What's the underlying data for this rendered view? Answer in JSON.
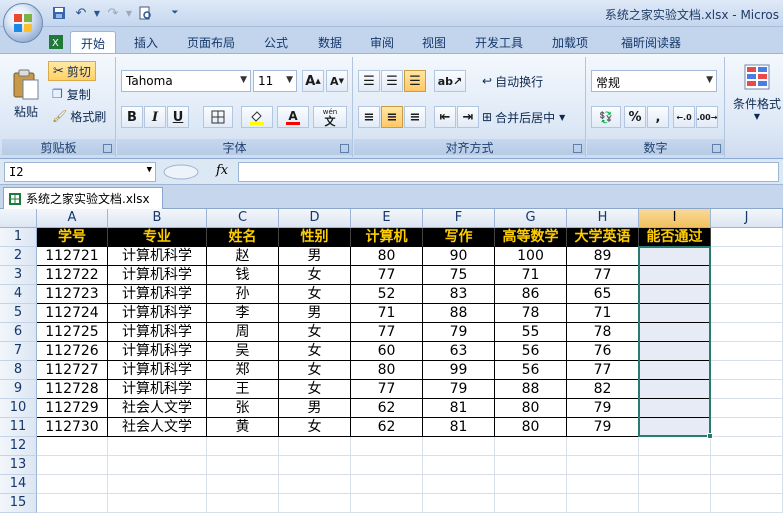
{
  "window": {
    "title": "系统之家实验文档.xlsx - Micros"
  },
  "ribbon_tabs": [
    "开始",
    "插入",
    "页面布局",
    "公式",
    "数据",
    "审阅",
    "视图",
    "开发工具",
    "加载项",
    "福昕阅读器"
  ],
  "clipboard": {
    "paste": "粘贴",
    "cut": "剪切",
    "copy": "复制",
    "format_painter": "格式刷",
    "label": "剪贴板"
  },
  "font": {
    "name": "Tahoma",
    "size": "11",
    "label": "字体",
    "grow": "A",
    "shrink": "A",
    "bold": "B",
    "italic": "I",
    "underline": "U",
    "font_color": "A",
    "wen": "wén",
    "wen_char": "文"
  },
  "alignment": {
    "wrap": "自动换行",
    "merge": "合并后居中",
    "label": "对齐方式"
  },
  "number": {
    "format": "常规",
    "percent": "%",
    "comma": ",",
    "label": "数字"
  },
  "styles": {
    "conditional": "条件格式"
  },
  "formula_bar": {
    "cell_ref": "I2",
    "fx": "fx",
    "value": ""
  },
  "workbook_tab": {
    "name": "系统之家实验文档.xlsx"
  },
  "sheet": {
    "columns": [
      "A",
      "B",
      "C",
      "D",
      "E",
      "F",
      "G",
      "H",
      "I",
      "J"
    ],
    "rows": [
      "1",
      "2",
      "3",
      "4",
      "5",
      "6",
      "7",
      "8",
      "9",
      "10",
      "11",
      "12",
      "13",
      "14",
      "15"
    ],
    "headers": [
      "学号",
      "专业",
      "姓名",
      "性别",
      "计算机",
      "写作",
      "高等数学",
      "大学英语",
      "能否通过"
    ],
    "data": [
      [
        "112721",
        "计算机科学",
        "赵",
        "男",
        "80",
        "90",
        "100",
        "89",
        ""
      ],
      [
        "112722",
        "计算机科学",
        "钱",
        "女",
        "77",
        "75",
        "71",
        "77",
        ""
      ],
      [
        "112723",
        "计算机科学",
        "孙",
        "女",
        "52",
        "83",
        "86",
        "65",
        ""
      ],
      [
        "112724",
        "计算机科学",
        "李",
        "男",
        "71",
        "88",
        "78",
        "71",
        ""
      ],
      [
        "112725",
        "计算机科学",
        "周",
        "女",
        "77",
        "79",
        "55",
        "78",
        ""
      ],
      [
        "112726",
        "计算机科学",
        "吴",
        "女",
        "60",
        "63",
        "56",
        "76",
        ""
      ],
      [
        "112727",
        "计算机科学",
        "郑",
        "女",
        "80",
        "99",
        "56",
        "77",
        ""
      ],
      [
        "112728",
        "计算机科学",
        "王",
        "女",
        "77",
        "79",
        "88",
        "82",
        ""
      ],
      [
        "112729",
        "社会人文学",
        "张",
        "男",
        "62",
        "81",
        "80",
        "79",
        ""
      ],
      [
        "112730",
        "社会人文学",
        "黄",
        "女",
        "62",
        "81",
        "80",
        "79",
        ""
      ]
    ]
  }
}
